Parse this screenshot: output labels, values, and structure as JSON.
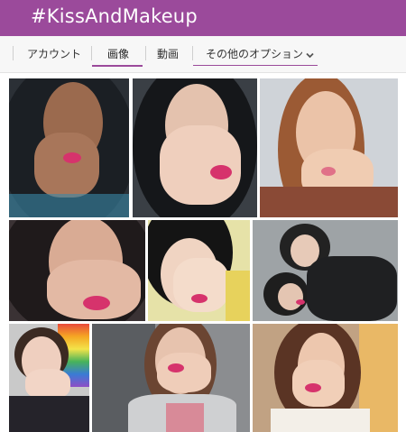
{
  "header": {
    "title": "#KissAndMakeup"
  },
  "tabs": [
    {
      "label": "アカウント",
      "active": false
    },
    {
      "label": "画像",
      "active": true
    },
    {
      "label": "動画",
      "active": false
    },
    {
      "label": "その他のオプション",
      "active": false,
      "icon": "chevron-down-icon"
    }
  ],
  "colors": {
    "brand": "#9b4a9b",
    "tab_bar": "#f7f7f7",
    "lip_print": "#d6336c"
  },
  "photos": [
    {
      "name": "photo-1"
    },
    {
      "name": "photo-2"
    },
    {
      "name": "photo-3"
    },
    {
      "name": "photo-4"
    },
    {
      "name": "photo-5"
    },
    {
      "name": "photo-6"
    },
    {
      "name": "photo-7"
    },
    {
      "name": "photo-8"
    },
    {
      "name": "photo-9"
    }
  ]
}
